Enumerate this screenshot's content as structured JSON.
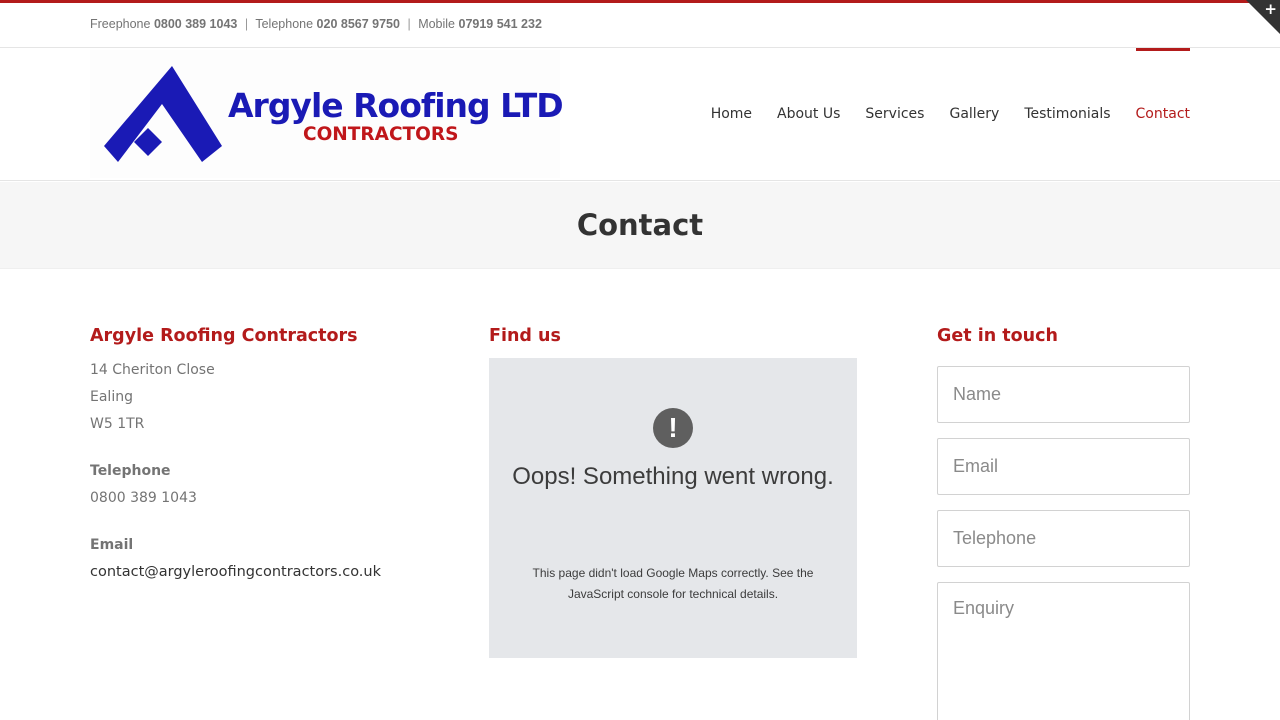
{
  "topbar": {
    "freephone_label": "Freephone",
    "freephone_number": "0800 389 1043",
    "telephone_label": "Telephone",
    "telephone_number": "020 8567 9750",
    "mobile_label": "Mobile",
    "mobile_number": "07919 541 232",
    "separator": "|"
  },
  "corner_toggle": {
    "symbol": "+",
    "icon": "plus-icon"
  },
  "logo": {
    "title": "Argyle Roofing LTD",
    "subtitle": "CONTRACTORS",
    "title_color": "#1a1ab5",
    "subtitle_color": "#c0161a"
  },
  "nav": {
    "items": [
      {
        "label": "Home",
        "active": false
      },
      {
        "label": "About Us",
        "active": false
      },
      {
        "label": "Services",
        "active": false
      },
      {
        "label": "Gallery",
        "active": false
      },
      {
        "label": "Testimonials",
        "active": false
      },
      {
        "label": "Contact",
        "active": true
      }
    ]
  },
  "page_title": "Contact",
  "address_col": {
    "heading": "Argyle Roofing Contractors",
    "lines": [
      "14 Cheriton Close",
      "Ealing",
      "W5 1TR"
    ],
    "telephone_label": "Telephone",
    "telephone_value": "0800 389 1043",
    "email_label": "Email",
    "email_value": "contact@argyleroofingcontractors.co.uk"
  },
  "map_col": {
    "heading": "Find us",
    "error_icon": "!",
    "error_title": "Oops! Something went wrong.",
    "error_body": "This page didn't load Google Maps correctly. See the JavaScript console for technical details."
  },
  "form_col": {
    "heading": "Get in touch",
    "name_placeholder": "Name",
    "email_placeholder": "Email",
    "telephone_placeholder": "Telephone",
    "enquiry_placeholder": "Enquiry"
  },
  "colors": {
    "accent": "#b31b1b",
    "text": "#747474",
    "dark_text": "#333333",
    "title_bar_bg": "#f6f6f6",
    "map_bg": "#e5e7ea"
  }
}
